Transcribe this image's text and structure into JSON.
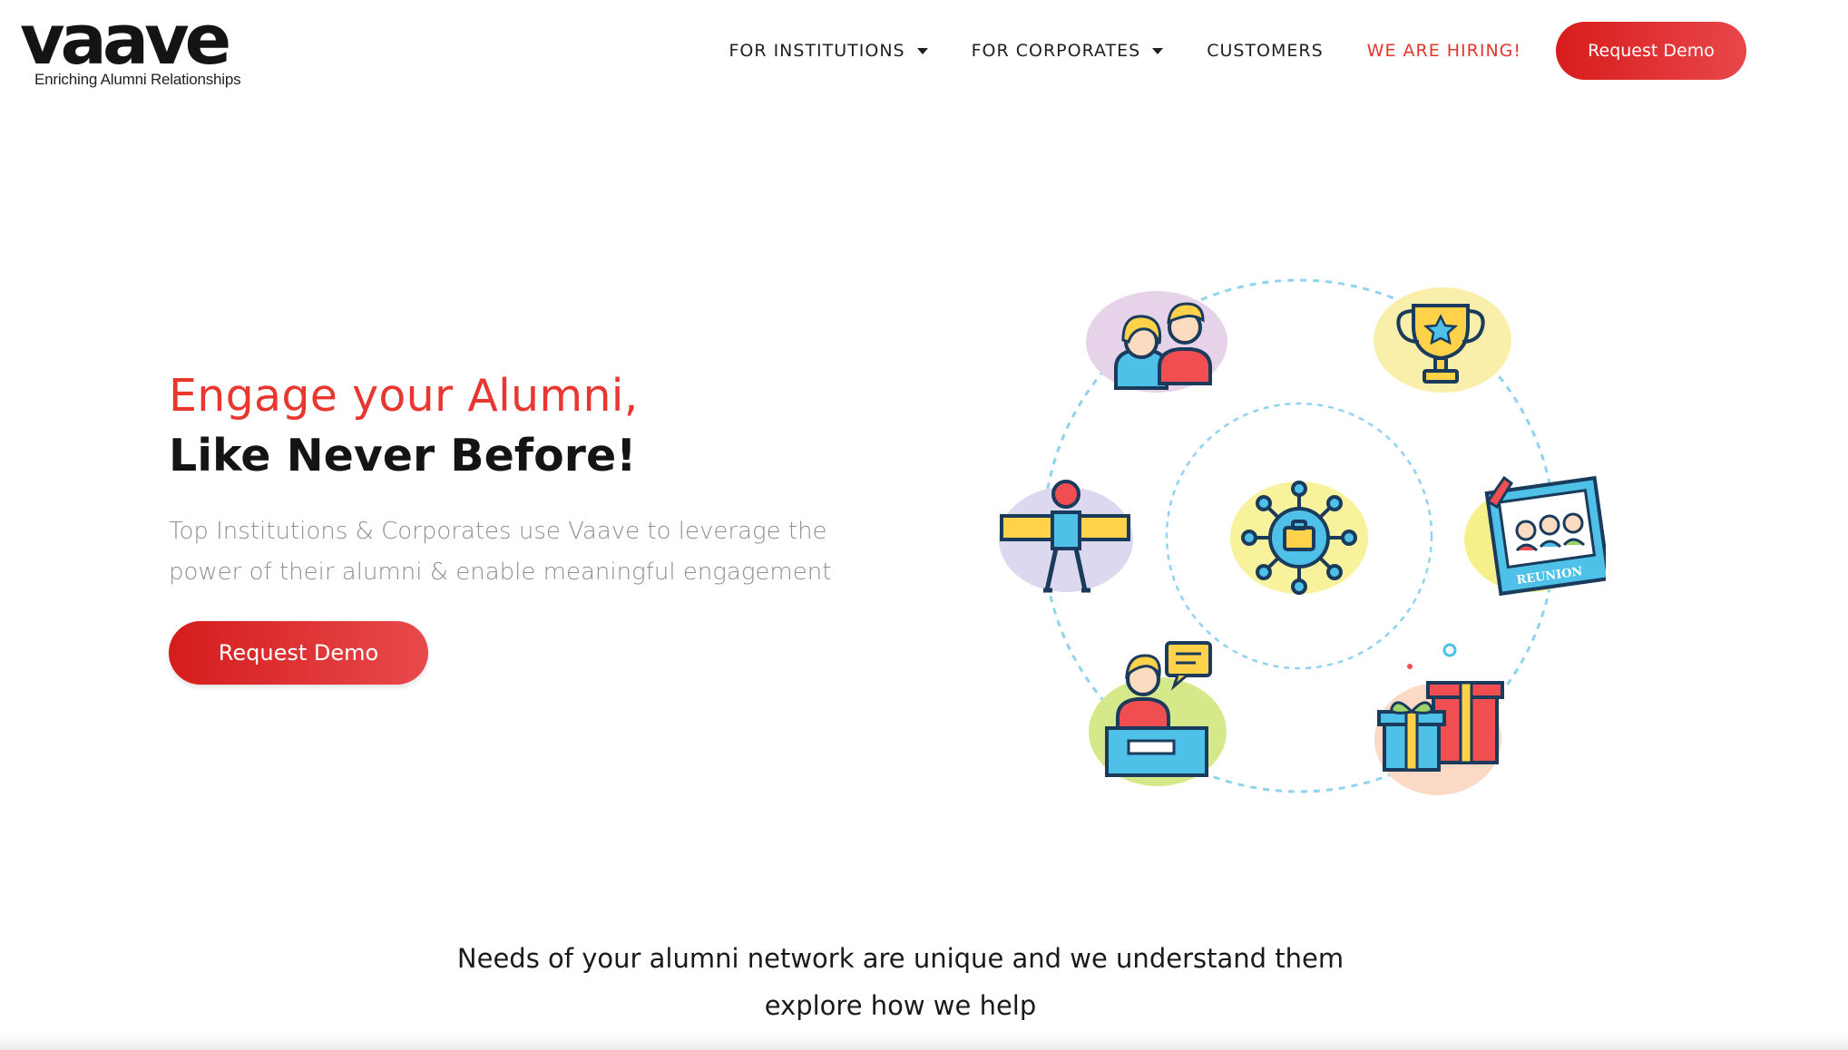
{
  "brand": {
    "name": "vaave",
    "tagline": "Enriching Alumni Relationships"
  },
  "nav": {
    "items": [
      {
        "label": "FOR INSTITUTIONS",
        "has_dropdown": true
      },
      {
        "label": "FOR CORPORATES",
        "has_dropdown": true
      },
      {
        "label": "CUSTOMERS",
        "has_dropdown": false
      },
      {
        "label": "WE ARE HIRING!",
        "has_dropdown": false,
        "color": "#e2352c"
      }
    ],
    "cta_label": "Request Demo"
  },
  "hero": {
    "title_line1": "Engage your Alumni,",
    "title_line2": "Like Never Before!",
    "subtitle": "Top Institutions & Corporates use Vaave to leverage the power of their alumni & enable meaningful engagement",
    "cta_label": "Request Demo"
  },
  "illustration": {
    "center_icon": "network-briefcase-icon",
    "orbit_icons": [
      "alumni-couple-icon",
      "trophy-icon",
      "reunion-photo-icon",
      "gift-boxes-icon",
      "mentor-desk-icon",
      "jetpack-person-icon"
    ],
    "reunion_banner": "REUNION"
  },
  "section": {
    "line1": "Needs of your alumni network are unique and we understand them",
    "line2": "explore how we help"
  },
  "colors": {
    "accent_red": "#e2352c",
    "button_red": "#d91c1c",
    "dashed_ring": "#8fd3ef"
  }
}
